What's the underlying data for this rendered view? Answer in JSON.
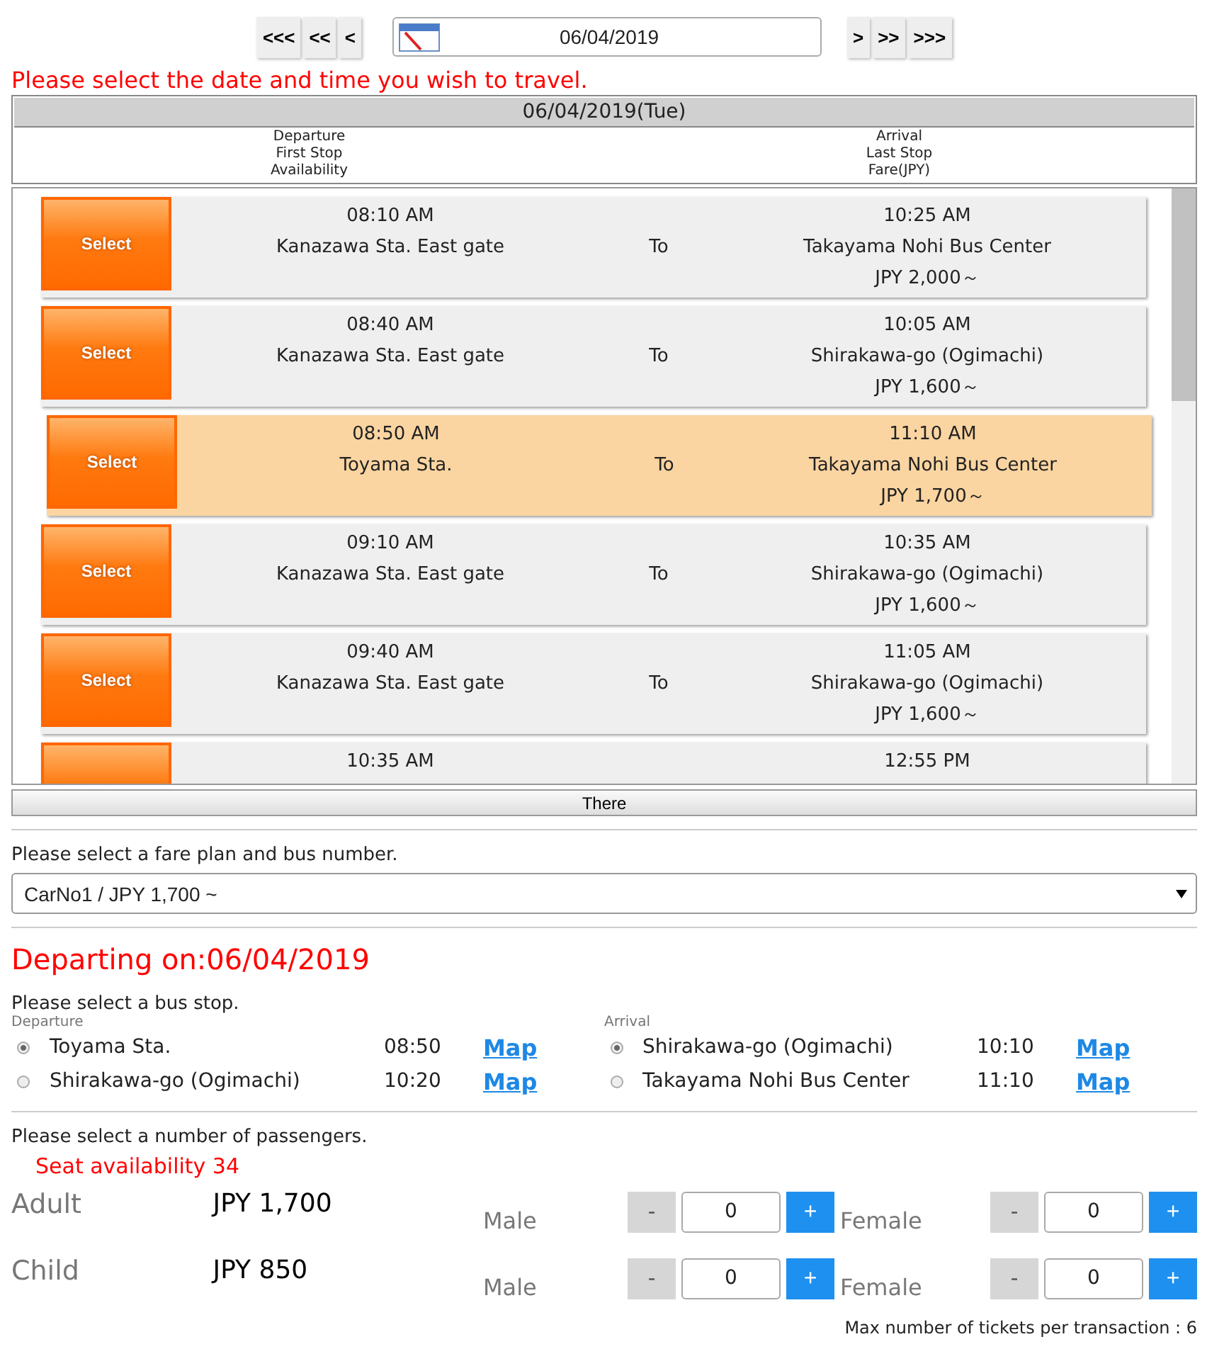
{
  "date_nav": {
    "back_buttons": [
      "<<<",
      "<<",
      "<"
    ],
    "date": "06/04/2019",
    "forward_buttons": [
      ">",
      ">>",
      ">>>"
    ]
  },
  "instruction": "Please select the date and time you wish to travel.",
  "timetable": {
    "day": "06/04/2019(Tue)",
    "header_left": [
      "Departure",
      "First Stop",
      "Availability"
    ],
    "header_right": [
      "Arrival",
      "Last Stop",
      "Fare(JPY)"
    ],
    "trips": [
      {
        "selected": false,
        "button": "Select",
        "dep_time": "08:10 AM",
        "dep_stop": "Kanazawa Sta. East gate",
        "to": "To",
        "arr_time": "10:25 AM",
        "arr_stop": "Takayama Nohi Bus Center",
        "fare": "JPY 2,000～"
      },
      {
        "selected": false,
        "button": "Select",
        "dep_time": "08:40 AM",
        "dep_stop": "Kanazawa Sta. East gate",
        "to": "To",
        "arr_time": "10:05 AM",
        "arr_stop": "Shirakawa-go (Ogimachi)",
        "fare": "JPY 1,600～"
      },
      {
        "selected": true,
        "button": "Select",
        "dep_time": "08:50 AM",
        "dep_stop": "Toyama Sta.",
        "to": "To",
        "arr_time": "11:10 AM",
        "arr_stop": "Takayama Nohi Bus Center",
        "fare": "JPY 1,700～"
      },
      {
        "selected": false,
        "button": "Select",
        "dep_time": "09:10 AM",
        "dep_stop": "Kanazawa Sta. East gate",
        "to": "To",
        "arr_time": "10:35 AM",
        "arr_stop": "Shirakawa-go (Ogimachi)",
        "fare": "JPY 1,600～"
      },
      {
        "selected": false,
        "button": "Select",
        "dep_time": "09:40 AM",
        "dep_stop": "Kanazawa Sta. East gate",
        "to": "To",
        "arr_time": "11:05 AM",
        "arr_stop": "Shirakawa-go (Ogimachi)",
        "fare": "JPY 1,600～"
      },
      {
        "selected": false,
        "dep_time": "10:35 AM",
        "arr_time": "12:55 PM"
      }
    ],
    "more_button": "There"
  },
  "fare_plan": {
    "label": "Please select a fare plan and bus number.",
    "value": "CarNo1 / JPY 1,700 ~"
  },
  "departing_title": "Departing on:06/04/2019",
  "bus_stop": {
    "label": "Please select a bus stop.",
    "groups": [
      {
        "title": "Departure",
        "stops": [
          {
            "selected": true,
            "name": "Toyama Sta.",
            "time": "08:50",
            "link": "Map"
          },
          {
            "selected": false,
            "name": "Shirakawa-go (Ogimachi)",
            "time": "10:20",
            "link": "Map"
          }
        ]
      },
      {
        "title": "Arrival",
        "stops": [
          {
            "selected": true,
            "name": "Shirakawa-go (Ogimachi)",
            "time": "10:10",
            "link": "Map"
          },
          {
            "selected": false,
            "name": "Takayama Nohi Bus Center",
            "time": "11:10",
            "link": "Map"
          }
        ]
      }
    ]
  },
  "passengers": {
    "label": "Please select a number of passengers.",
    "availability": "Seat availability 34",
    "rows": [
      {
        "type": "Adult",
        "price": "JPY 1,700",
        "counters": [
          {
            "label": "Male",
            "minus": "-",
            "value": "0",
            "plus": "+",
            "minus_disabled": true
          },
          {
            "label": "Female",
            "minus": "-",
            "value": "0",
            "plus": "+",
            "minus_disabled": true
          }
        ]
      },
      {
        "type": "Child",
        "price": "JPY 850",
        "counters": [
          {
            "label": "Male",
            "minus": "-",
            "value": "0",
            "plus": "+",
            "minus_disabled": true
          },
          {
            "label": "Female",
            "minus": "-",
            "value": "0",
            "plus": "+",
            "minus_disabled": true
          }
        ]
      }
    ],
    "max_note": "Max number of tickets per transaction : 6"
  }
}
